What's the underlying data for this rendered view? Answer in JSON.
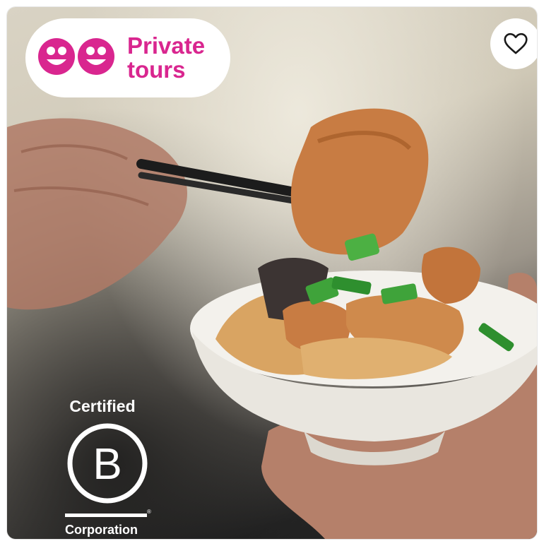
{
  "badge": {
    "icon": "smiley-faces-icon",
    "line1": "Private",
    "line2": "tours",
    "color": "#d9268f"
  },
  "heart_button": {
    "icon": "heart-outline-icon"
  },
  "certification": {
    "top_label": "Certified",
    "letter": "B",
    "bottom_label": "Corporation",
    "icon": "b-corp-logo"
  },
  "photo": {
    "icon": "food-bowl-chopsticks-image"
  }
}
